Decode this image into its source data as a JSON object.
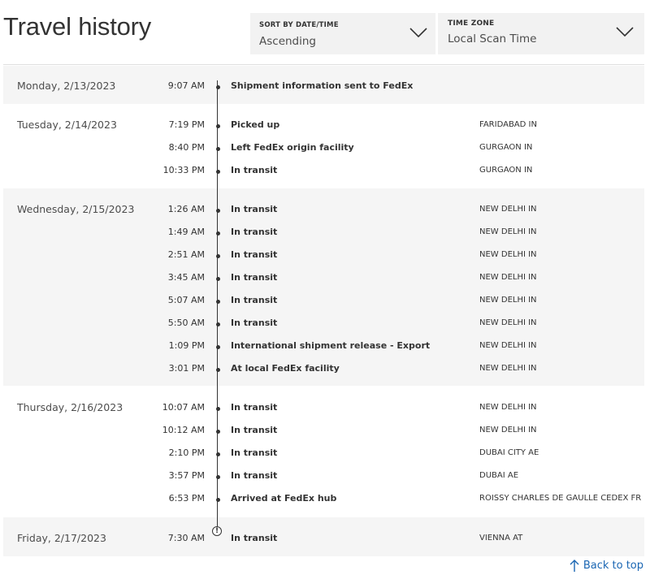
{
  "page": {
    "title": "Travel history"
  },
  "sort": {
    "label": "SORT BY DATE/TIME",
    "value": "Ascending"
  },
  "timezone": {
    "label": "TIME ZONE",
    "value": "Local Scan Time"
  },
  "back_to_top": "Back to top",
  "groups": [
    {
      "day": "Monday, 2/13/2023",
      "events": [
        {
          "time": "9:07 AM",
          "description": "Shipment information sent to FedEx",
          "location": ""
        }
      ]
    },
    {
      "day": "Tuesday, 2/14/2023",
      "events": [
        {
          "time": "7:19 PM",
          "description": "Picked up",
          "location": "FARIDABAD IN"
        },
        {
          "time": "8:40 PM",
          "description": "Left FedEx origin facility",
          "location": "GURGAON IN"
        },
        {
          "time": "10:33 PM",
          "description": "In transit",
          "location": "GURGAON IN"
        }
      ]
    },
    {
      "day": "Wednesday, 2/15/2023",
      "events": [
        {
          "time": "1:26 AM",
          "description": "In transit",
          "location": "NEW DELHI IN"
        },
        {
          "time": "1:49 AM",
          "description": "In transit",
          "location": "NEW DELHI IN"
        },
        {
          "time": "2:51 AM",
          "description": "In transit",
          "location": "NEW DELHI IN"
        },
        {
          "time": "3:45 AM",
          "description": "In transit",
          "location": "NEW DELHI IN"
        },
        {
          "time": "5:07 AM",
          "description": "In transit",
          "location": "NEW DELHI IN"
        },
        {
          "time": "5:50 AM",
          "description": "In transit",
          "location": "NEW DELHI IN"
        },
        {
          "time": "1:09 PM",
          "description": "International shipment release - Export",
          "location": "NEW DELHI IN"
        },
        {
          "time": "3:01 PM",
          "description": "At local FedEx facility",
          "location": "NEW DELHI IN"
        }
      ]
    },
    {
      "day": "Thursday, 2/16/2023",
      "events": [
        {
          "time": "10:07 AM",
          "description": "In transit",
          "location": "NEW DELHI IN"
        },
        {
          "time": "10:12 AM",
          "description": "In transit",
          "location": "NEW DELHI IN"
        },
        {
          "time": "2:10 PM",
          "description": "In transit",
          "location": "DUBAI CITY AE"
        },
        {
          "time": "3:57 PM",
          "description": "In transit",
          "location": "DUBAI AE"
        },
        {
          "time": "6:53 PM",
          "description": "Arrived at FedEx hub",
          "location": "ROISSY CHARLES DE GAULLE CEDEX FR"
        }
      ]
    },
    {
      "day": "Friday, 2/17/2023",
      "events": [
        {
          "time": "7:30 AM",
          "description": "In transit",
          "location": "VIENNA AT"
        }
      ]
    }
  ],
  "icons": {
    "dropdown": "chevron-down-icon",
    "current": "exclamation-circle-icon",
    "back": "arrow-up-icon"
  },
  "colors": {
    "link": "#1a66b3",
    "shaded_row": "#f5f5f5",
    "dropdown_bg": "#f2f2f2"
  }
}
